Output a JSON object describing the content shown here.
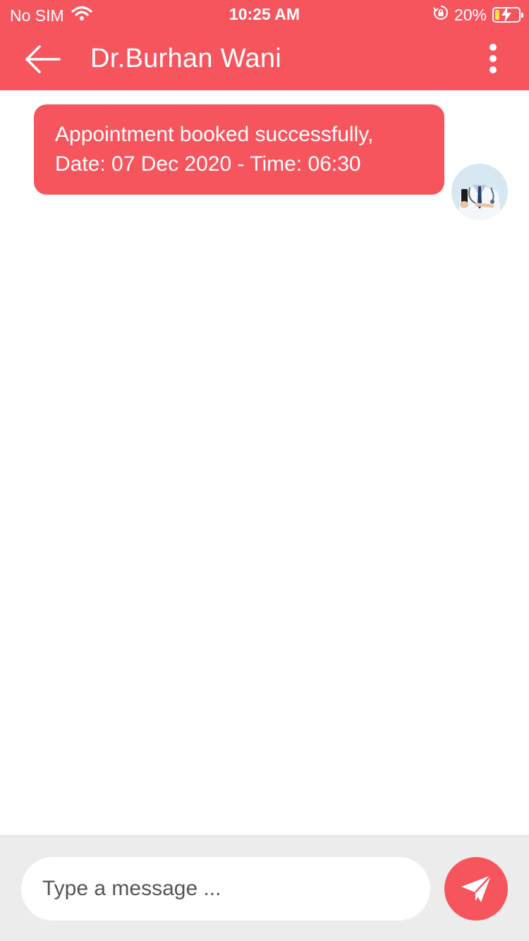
{
  "status_bar": {
    "carrier": "No SIM",
    "time": "10:25 AM",
    "battery_percent_label": "20%",
    "battery_level": 0.2
  },
  "header": {
    "title": "Dr.Burhan Wani",
    "back_icon": "arrow-left-icon",
    "menu_icon": "more-vertical-icon"
  },
  "messages": [
    {
      "lines": [
        "Appointment booked successfully,",
        "Date: 07 Dec 2020 - Time: 06:30"
      ],
      "avatar_icon": "doctor-avatar"
    }
  ],
  "composer": {
    "placeholder": "Type a message ...",
    "value": "",
    "send_icon": "paper-plane-icon"
  },
  "colors": {
    "accent": "#f7555e",
    "composer_bg": "#ececec",
    "battery_fill": "#ffe04a"
  }
}
